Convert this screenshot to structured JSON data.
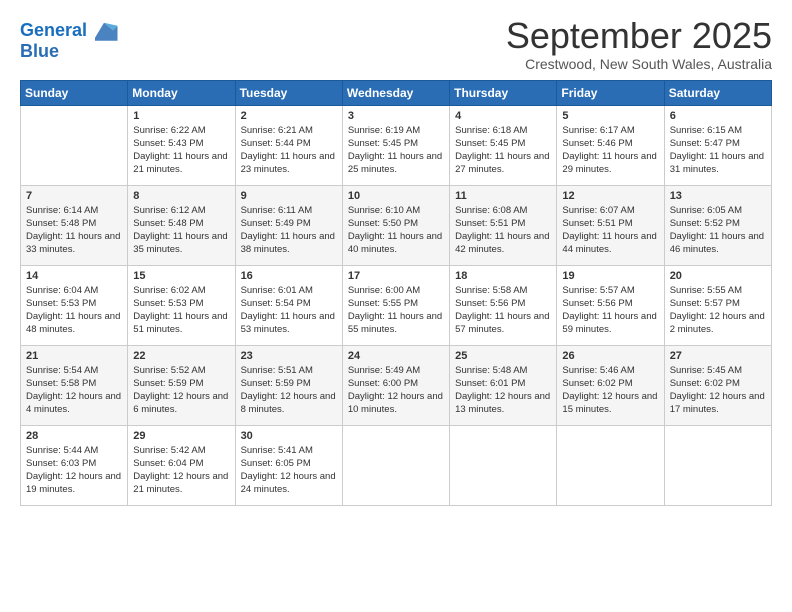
{
  "logo": {
    "line1": "General",
    "line2": "Blue"
  },
  "title": "September 2025",
  "subtitle": "Crestwood, New South Wales, Australia",
  "weekdays": [
    "Sunday",
    "Monday",
    "Tuesday",
    "Wednesday",
    "Thursday",
    "Friday",
    "Saturday"
  ],
  "weeks": [
    [
      {
        "day": "",
        "sunrise": "",
        "sunset": "",
        "daylight": ""
      },
      {
        "day": "1",
        "sunrise": "Sunrise: 6:22 AM",
        "sunset": "Sunset: 5:43 PM",
        "daylight": "Daylight: 11 hours and 21 minutes."
      },
      {
        "day": "2",
        "sunrise": "Sunrise: 6:21 AM",
        "sunset": "Sunset: 5:44 PM",
        "daylight": "Daylight: 11 hours and 23 minutes."
      },
      {
        "day": "3",
        "sunrise": "Sunrise: 6:19 AM",
        "sunset": "Sunset: 5:45 PM",
        "daylight": "Daylight: 11 hours and 25 minutes."
      },
      {
        "day": "4",
        "sunrise": "Sunrise: 6:18 AM",
        "sunset": "Sunset: 5:45 PM",
        "daylight": "Daylight: 11 hours and 27 minutes."
      },
      {
        "day": "5",
        "sunrise": "Sunrise: 6:17 AM",
        "sunset": "Sunset: 5:46 PM",
        "daylight": "Daylight: 11 hours and 29 minutes."
      },
      {
        "day": "6",
        "sunrise": "Sunrise: 6:15 AM",
        "sunset": "Sunset: 5:47 PM",
        "daylight": "Daylight: 11 hours and 31 minutes."
      }
    ],
    [
      {
        "day": "7",
        "sunrise": "Sunrise: 6:14 AM",
        "sunset": "Sunset: 5:48 PM",
        "daylight": "Daylight: 11 hours and 33 minutes."
      },
      {
        "day": "8",
        "sunrise": "Sunrise: 6:12 AM",
        "sunset": "Sunset: 5:48 PM",
        "daylight": "Daylight: 11 hours and 35 minutes."
      },
      {
        "day": "9",
        "sunrise": "Sunrise: 6:11 AM",
        "sunset": "Sunset: 5:49 PM",
        "daylight": "Daylight: 11 hours and 38 minutes."
      },
      {
        "day": "10",
        "sunrise": "Sunrise: 6:10 AM",
        "sunset": "Sunset: 5:50 PM",
        "daylight": "Daylight: 11 hours and 40 minutes."
      },
      {
        "day": "11",
        "sunrise": "Sunrise: 6:08 AM",
        "sunset": "Sunset: 5:51 PM",
        "daylight": "Daylight: 11 hours and 42 minutes."
      },
      {
        "day": "12",
        "sunrise": "Sunrise: 6:07 AM",
        "sunset": "Sunset: 5:51 PM",
        "daylight": "Daylight: 11 hours and 44 minutes."
      },
      {
        "day": "13",
        "sunrise": "Sunrise: 6:05 AM",
        "sunset": "Sunset: 5:52 PM",
        "daylight": "Daylight: 11 hours and 46 minutes."
      }
    ],
    [
      {
        "day": "14",
        "sunrise": "Sunrise: 6:04 AM",
        "sunset": "Sunset: 5:53 PM",
        "daylight": "Daylight: 11 hours and 48 minutes."
      },
      {
        "day": "15",
        "sunrise": "Sunrise: 6:02 AM",
        "sunset": "Sunset: 5:53 PM",
        "daylight": "Daylight: 11 hours and 51 minutes."
      },
      {
        "day": "16",
        "sunrise": "Sunrise: 6:01 AM",
        "sunset": "Sunset: 5:54 PM",
        "daylight": "Daylight: 11 hours and 53 minutes."
      },
      {
        "day": "17",
        "sunrise": "Sunrise: 6:00 AM",
        "sunset": "Sunset: 5:55 PM",
        "daylight": "Daylight: 11 hours and 55 minutes."
      },
      {
        "day": "18",
        "sunrise": "Sunrise: 5:58 AM",
        "sunset": "Sunset: 5:56 PM",
        "daylight": "Daylight: 11 hours and 57 minutes."
      },
      {
        "day": "19",
        "sunrise": "Sunrise: 5:57 AM",
        "sunset": "Sunset: 5:56 PM",
        "daylight": "Daylight: 11 hours and 59 minutes."
      },
      {
        "day": "20",
        "sunrise": "Sunrise: 5:55 AM",
        "sunset": "Sunset: 5:57 PM",
        "daylight": "Daylight: 12 hours and 2 minutes."
      }
    ],
    [
      {
        "day": "21",
        "sunrise": "Sunrise: 5:54 AM",
        "sunset": "Sunset: 5:58 PM",
        "daylight": "Daylight: 12 hours and 4 minutes."
      },
      {
        "day": "22",
        "sunrise": "Sunrise: 5:52 AM",
        "sunset": "Sunset: 5:59 PM",
        "daylight": "Daylight: 12 hours and 6 minutes."
      },
      {
        "day": "23",
        "sunrise": "Sunrise: 5:51 AM",
        "sunset": "Sunset: 5:59 PM",
        "daylight": "Daylight: 12 hours and 8 minutes."
      },
      {
        "day": "24",
        "sunrise": "Sunrise: 5:49 AM",
        "sunset": "Sunset: 6:00 PM",
        "daylight": "Daylight: 12 hours and 10 minutes."
      },
      {
        "day": "25",
        "sunrise": "Sunrise: 5:48 AM",
        "sunset": "Sunset: 6:01 PM",
        "daylight": "Daylight: 12 hours and 13 minutes."
      },
      {
        "day": "26",
        "sunrise": "Sunrise: 5:46 AM",
        "sunset": "Sunset: 6:02 PM",
        "daylight": "Daylight: 12 hours and 15 minutes."
      },
      {
        "day": "27",
        "sunrise": "Sunrise: 5:45 AM",
        "sunset": "Sunset: 6:02 PM",
        "daylight": "Daylight: 12 hours and 17 minutes."
      }
    ],
    [
      {
        "day": "28",
        "sunrise": "Sunrise: 5:44 AM",
        "sunset": "Sunset: 6:03 PM",
        "daylight": "Daylight: 12 hours and 19 minutes."
      },
      {
        "day": "29",
        "sunrise": "Sunrise: 5:42 AM",
        "sunset": "Sunset: 6:04 PM",
        "daylight": "Daylight: 12 hours and 21 minutes."
      },
      {
        "day": "30",
        "sunrise": "Sunrise: 5:41 AM",
        "sunset": "Sunset: 6:05 PM",
        "daylight": "Daylight: 12 hours and 24 minutes."
      },
      {
        "day": "",
        "sunrise": "",
        "sunset": "",
        "daylight": ""
      },
      {
        "day": "",
        "sunrise": "",
        "sunset": "",
        "daylight": ""
      },
      {
        "day": "",
        "sunrise": "",
        "sunset": "",
        "daylight": ""
      },
      {
        "day": "",
        "sunrise": "",
        "sunset": "",
        "daylight": ""
      }
    ]
  ]
}
